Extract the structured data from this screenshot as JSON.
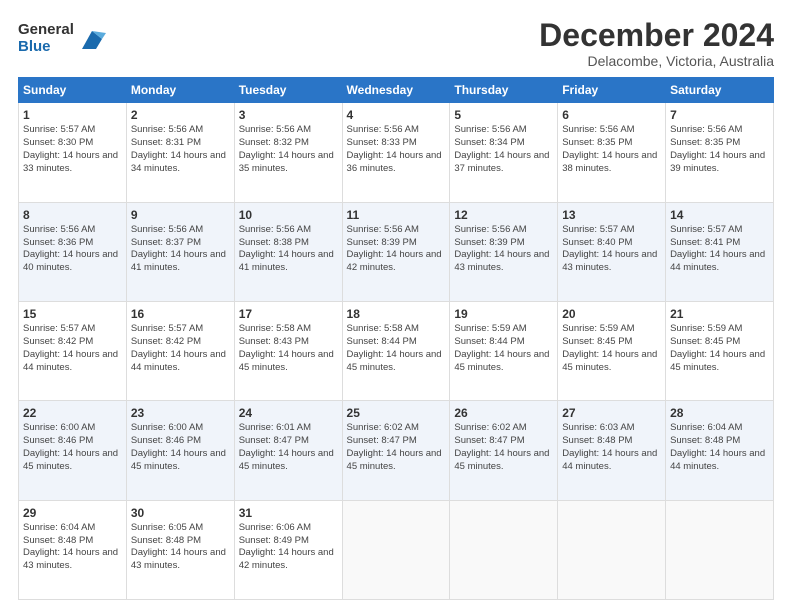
{
  "logo": {
    "general": "General",
    "blue": "Blue"
  },
  "title": "December 2024",
  "location": "Delacombe, Victoria, Australia",
  "headers": [
    "Sunday",
    "Monday",
    "Tuesday",
    "Wednesday",
    "Thursday",
    "Friday",
    "Saturday"
  ],
  "weeks": [
    [
      {
        "day": "1",
        "sunrise": "5:57 AM",
        "sunset": "8:30 PM",
        "daylight": "14 hours and 33 minutes."
      },
      {
        "day": "2",
        "sunrise": "5:56 AM",
        "sunset": "8:31 PM",
        "daylight": "14 hours and 34 minutes."
      },
      {
        "day": "3",
        "sunrise": "5:56 AM",
        "sunset": "8:32 PM",
        "daylight": "14 hours and 35 minutes."
      },
      {
        "day": "4",
        "sunrise": "5:56 AM",
        "sunset": "8:33 PM",
        "daylight": "14 hours and 36 minutes."
      },
      {
        "day": "5",
        "sunrise": "5:56 AM",
        "sunset": "8:34 PM",
        "daylight": "14 hours and 37 minutes."
      },
      {
        "day": "6",
        "sunrise": "5:56 AM",
        "sunset": "8:35 PM",
        "daylight": "14 hours and 38 minutes."
      },
      {
        "day": "7",
        "sunrise": "5:56 AM",
        "sunset": "8:35 PM",
        "daylight": "14 hours and 39 minutes."
      }
    ],
    [
      {
        "day": "8",
        "sunrise": "5:56 AM",
        "sunset": "8:36 PM",
        "daylight": "14 hours and 40 minutes."
      },
      {
        "day": "9",
        "sunrise": "5:56 AM",
        "sunset": "8:37 PM",
        "daylight": "14 hours and 41 minutes."
      },
      {
        "day": "10",
        "sunrise": "5:56 AM",
        "sunset": "8:38 PM",
        "daylight": "14 hours and 41 minutes."
      },
      {
        "day": "11",
        "sunrise": "5:56 AM",
        "sunset": "8:39 PM",
        "daylight": "14 hours and 42 minutes."
      },
      {
        "day": "12",
        "sunrise": "5:56 AM",
        "sunset": "8:39 PM",
        "daylight": "14 hours and 43 minutes."
      },
      {
        "day": "13",
        "sunrise": "5:57 AM",
        "sunset": "8:40 PM",
        "daylight": "14 hours and 43 minutes."
      },
      {
        "day": "14",
        "sunrise": "5:57 AM",
        "sunset": "8:41 PM",
        "daylight": "14 hours and 44 minutes."
      }
    ],
    [
      {
        "day": "15",
        "sunrise": "5:57 AM",
        "sunset": "8:42 PM",
        "daylight": "14 hours and 44 minutes."
      },
      {
        "day": "16",
        "sunrise": "5:57 AM",
        "sunset": "8:42 PM",
        "daylight": "14 hours and 44 minutes."
      },
      {
        "day": "17",
        "sunrise": "5:58 AM",
        "sunset": "8:43 PM",
        "daylight": "14 hours and 45 minutes."
      },
      {
        "day": "18",
        "sunrise": "5:58 AM",
        "sunset": "8:44 PM",
        "daylight": "14 hours and 45 minutes."
      },
      {
        "day": "19",
        "sunrise": "5:59 AM",
        "sunset": "8:44 PM",
        "daylight": "14 hours and 45 minutes."
      },
      {
        "day": "20",
        "sunrise": "5:59 AM",
        "sunset": "8:45 PM",
        "daylight": "14 hours and 45 minutes."
      },
      {
        "day": "21",
        "sunrise": "5:59 AM",
        "sunset": "8:45 PM",
        "daylight": "14 hours and 45 minutes."
      }
    ],
    [
      {
        "day": "22",
        "sunrise": "6:00 AM",
        "sunset": "8:46 PM",
        "daylight": "14 hours and 45 minutes."
      },
      {
        "day": "23",
        "sunrise": "6:00 AM",
        "sunset": "8:46 PM",
        "daylight": "14 hours and 45 minutes."
      },
      {
        "day": "24",
        "sunrise": "6:01 AM",
        "sunset": "8:47 PM",
        "daylight": "14 hours and 45 minutes."
      },
      {
        "day": "25",
        "sunrise": "6:02 AM",
        "sunset": "8:47 PM",
        "daylight": "14 hours and 45 minutes."
      },
      {
        "day": "26",
        "sunrise": "6:02 AM",
        "sunset": "8:47 PM",
        "daylight": "14 hours and 45 minutes."
      },
      {
        "day": "27",
        "sunrise": "6:03 AM",
        "sunset": "8:48 PM",
        "daylight": "14 hours and 44 minutes."
      },
      {
        "day": "28",
        "sunrise": "6:04 AM",
        "sunset": "8:48 PM",
        "daylight": "14 hours and 44 minutes."
      }
    ],
    [
      {
        "day": "29",
        "sunrise": "6:04 AM",
        "sunset": "8:48 PM",
        "daylight": "14 hours and 43 minutes."
      },
      {
        "day": "30",
        "sunrise": "6:05 AM",
        "sunset": "8:48 PM",
        "daylight": "14 hours and 43 minutes."
      },
      {
        "day": "31",
        "sunrise": "6:06 AM",
        "sunset": "8:49 PM",
        "daylight": "14 hours and 42 minutes."
      },
      null,
      null,
      null,
      null
    ]
  ]
}
